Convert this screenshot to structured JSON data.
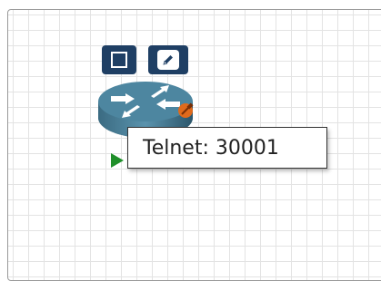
{
  "node": {
    "name": "router",
    "stop_icon": "stop-square-icon",
    "edit_icon": "pencil-icon",
    "run_icon": "play-icon",
    "console_icon": "console-plug-icon"
  },
  "tooltip": {
    "text": "Telnet: 30001"
  },
  "colors": {
    "button_bg": "#1f3f64",
    "router_body": "#3d6f86",
    "plug": "#e06a1c",
    "play": "#1f8f2a"
  }
}
